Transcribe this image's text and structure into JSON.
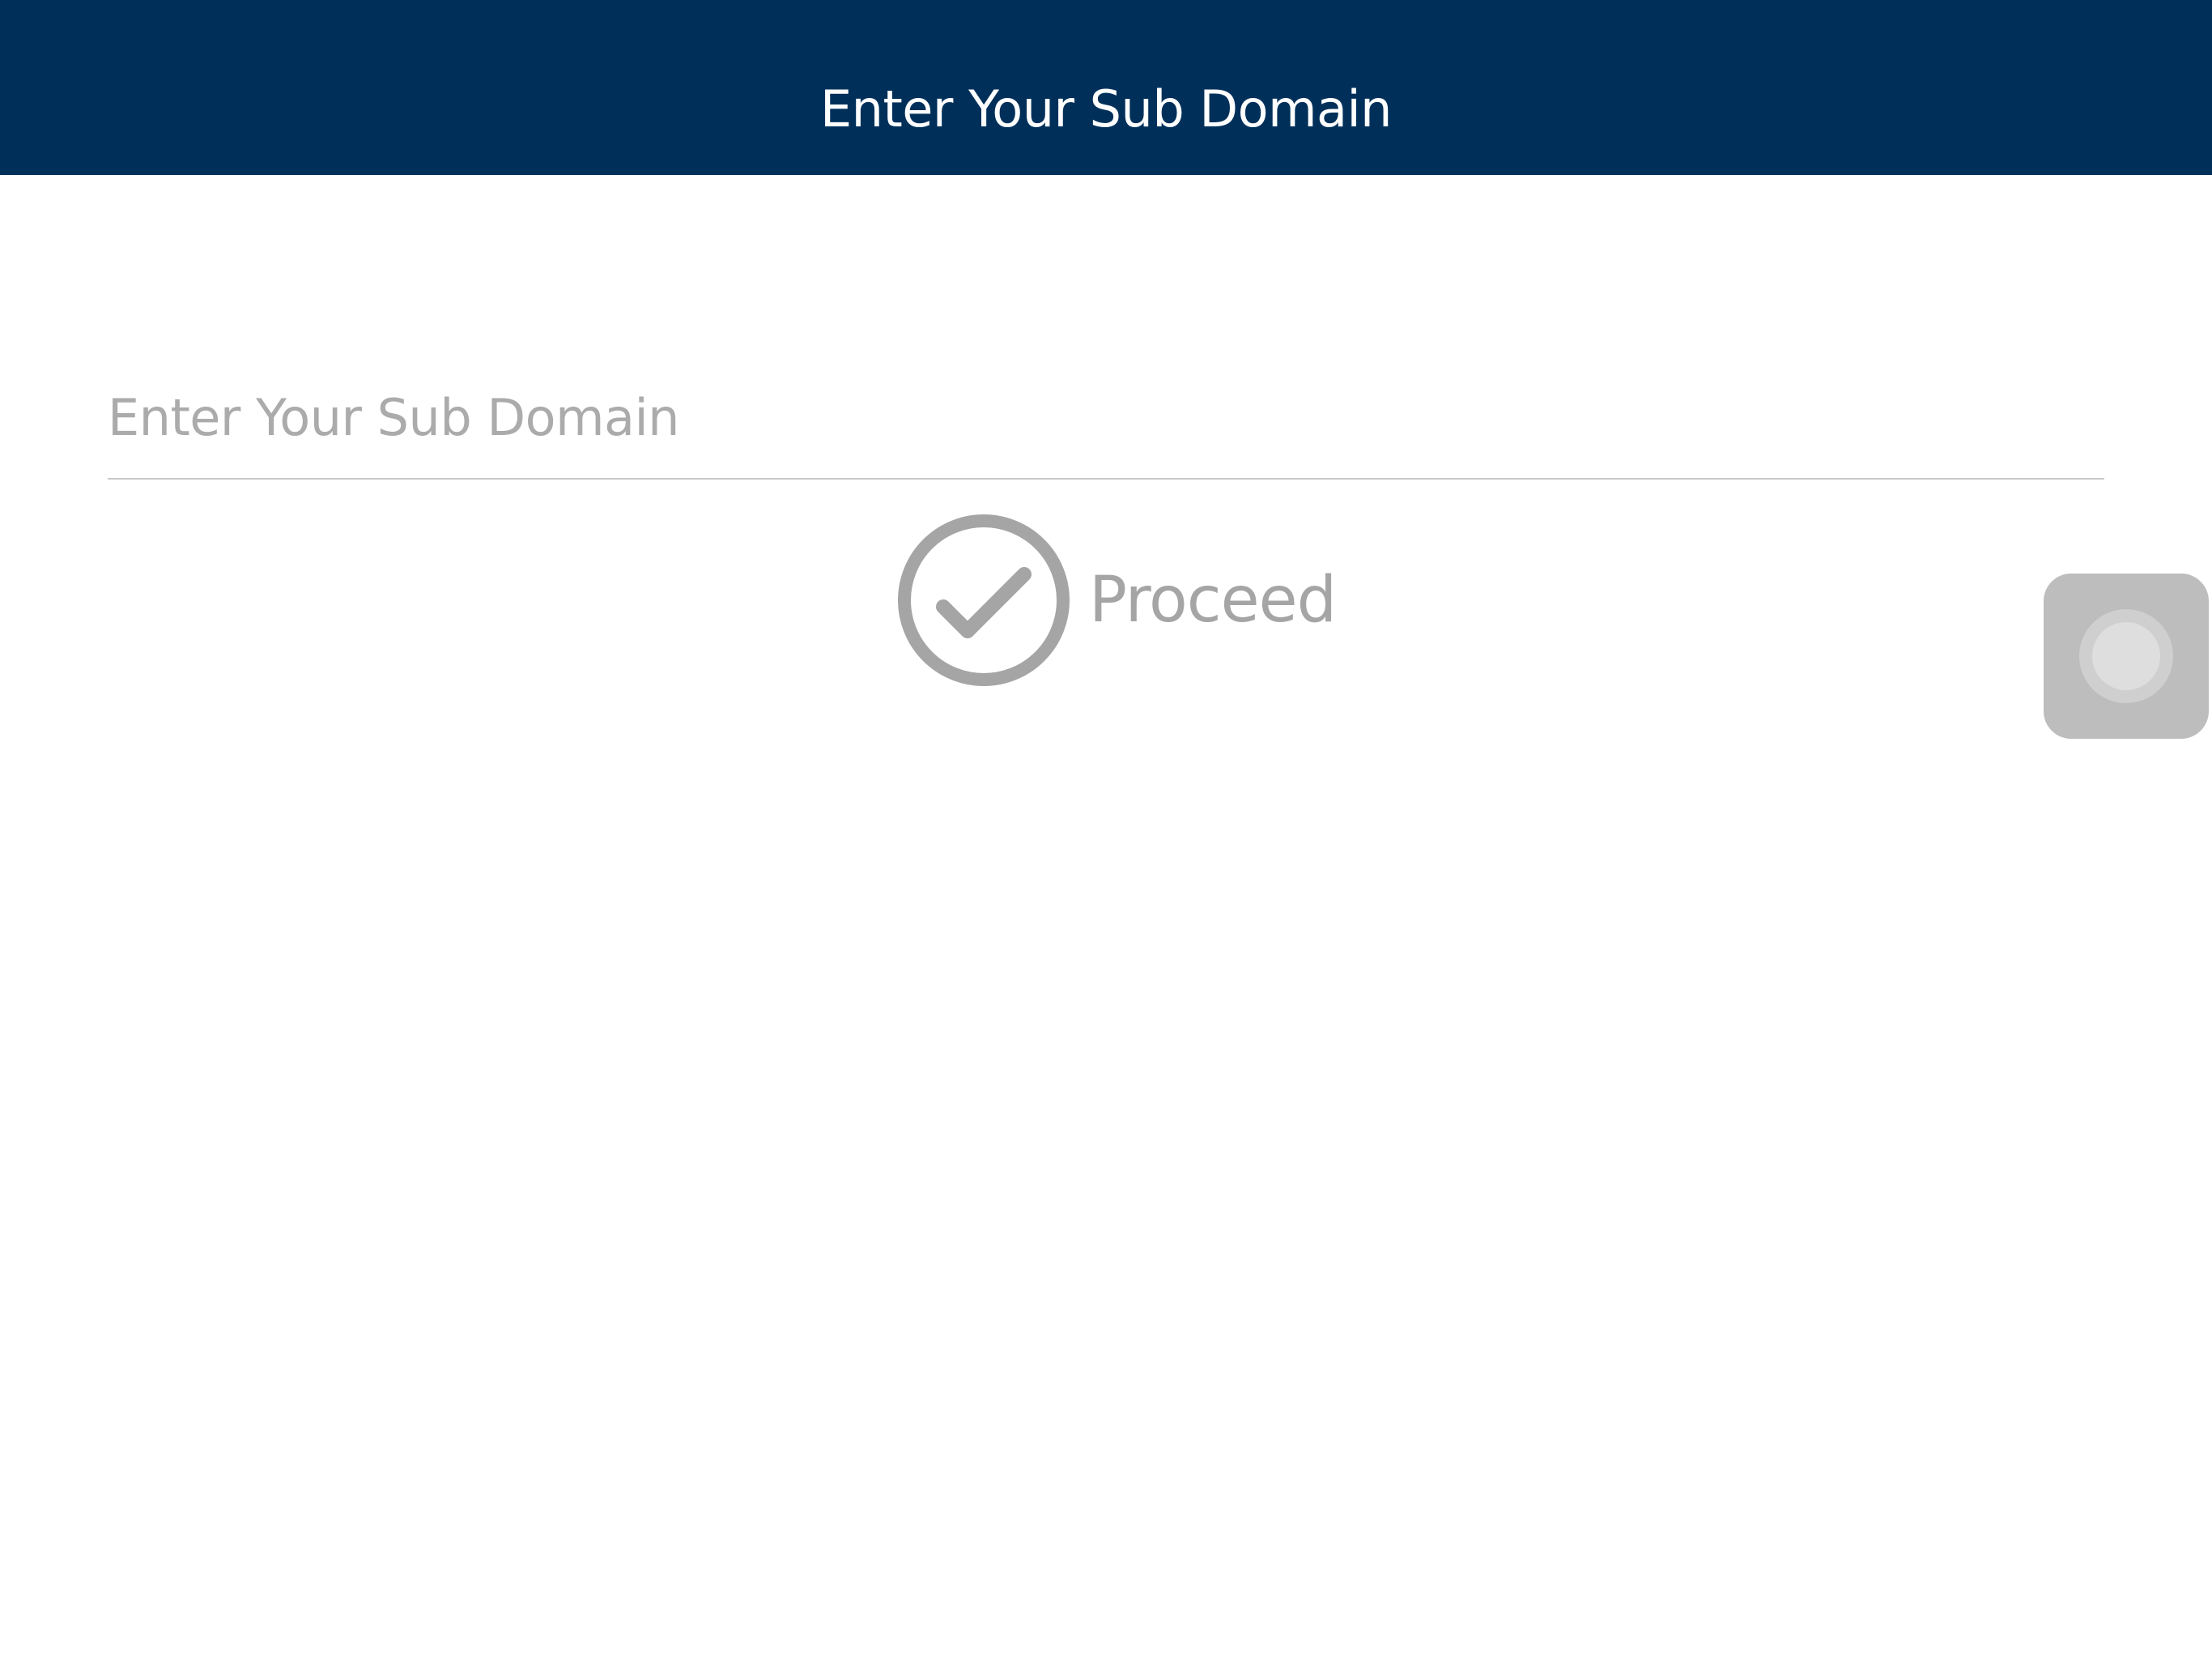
{
  "header": {
    "title": "Enter Your Sub Domain"
  },
  "form": {
    "subdomain_value": "",
    "subdomain_placeholder": "Enter Your Sub Domain",
    "proceed_label": "Proceed"
  },
  "icons": {
    "proceed": "check-circle-icon",
    "assistive_touch": "assistive-touch-icon"
  },
  "colors": {
    "header_bg": "#00305a",
    "header_text": "#ffffff",
    "placeholder": "#ababab",
    "proceed": "#a5a5a5"
  }
}
